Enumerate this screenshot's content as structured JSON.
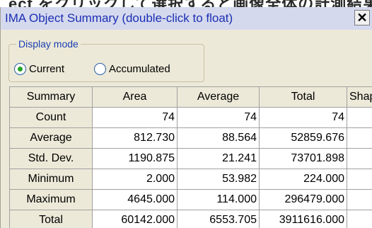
{
  "banner_text": "ect をクリックして選択すると画像全体の計測結果",
  "window": {
    "title": "IMA Object Summary   (double-click to float)",
    "close_symbol": "✕"
  },
  "display_mode": {
    "legend": "Display mode",
    "options": [
      {
        "label": "Current",
        "selected": true
      },
      {
        "label": "Accumulated",
        "selected": false
      }
    ]
  },
  "table": {
    "headers": [
      "Summary",
      "Area",
      "Average",
      "Total",
      "Shap"
    ],
    "rows": [
      {
        "label": "Count",
        "values": [
          "74",
          "74",
          "74"
        ]
      },
      {
        "label": "Average",
        "values": [
          "812.730",
          "88.564",
          "52859.676"
        ]
      },
      {
        "label": "Std. Dev.",
        "values": [
          "1190.875",
          "21.241",
          "73701.898"
        ]
      },
      {
        "label": "Minimum",
        "values": [
          "2.000",
          "53.982",
          "224.000"
        ]
      },
      {
        "label": "Maximum",
        "values": [
          "4645.000",
          "114.000",
          "296479.000"
        ]
      },
      {
        "label": "Total",
        "values": [
          "60142.000",
          "6553.705",
          "3911616.000"
        ]
      }
    ]
  },
  "colors": {
    "title_text": "#1b2fb3",
    "titlebar_bg": "#d5d9ee",
    "window_bg": "#ece9d8",
    "legend_text": "#1c3fb0",
    "radio_selected": "#27a427"
  }
}
